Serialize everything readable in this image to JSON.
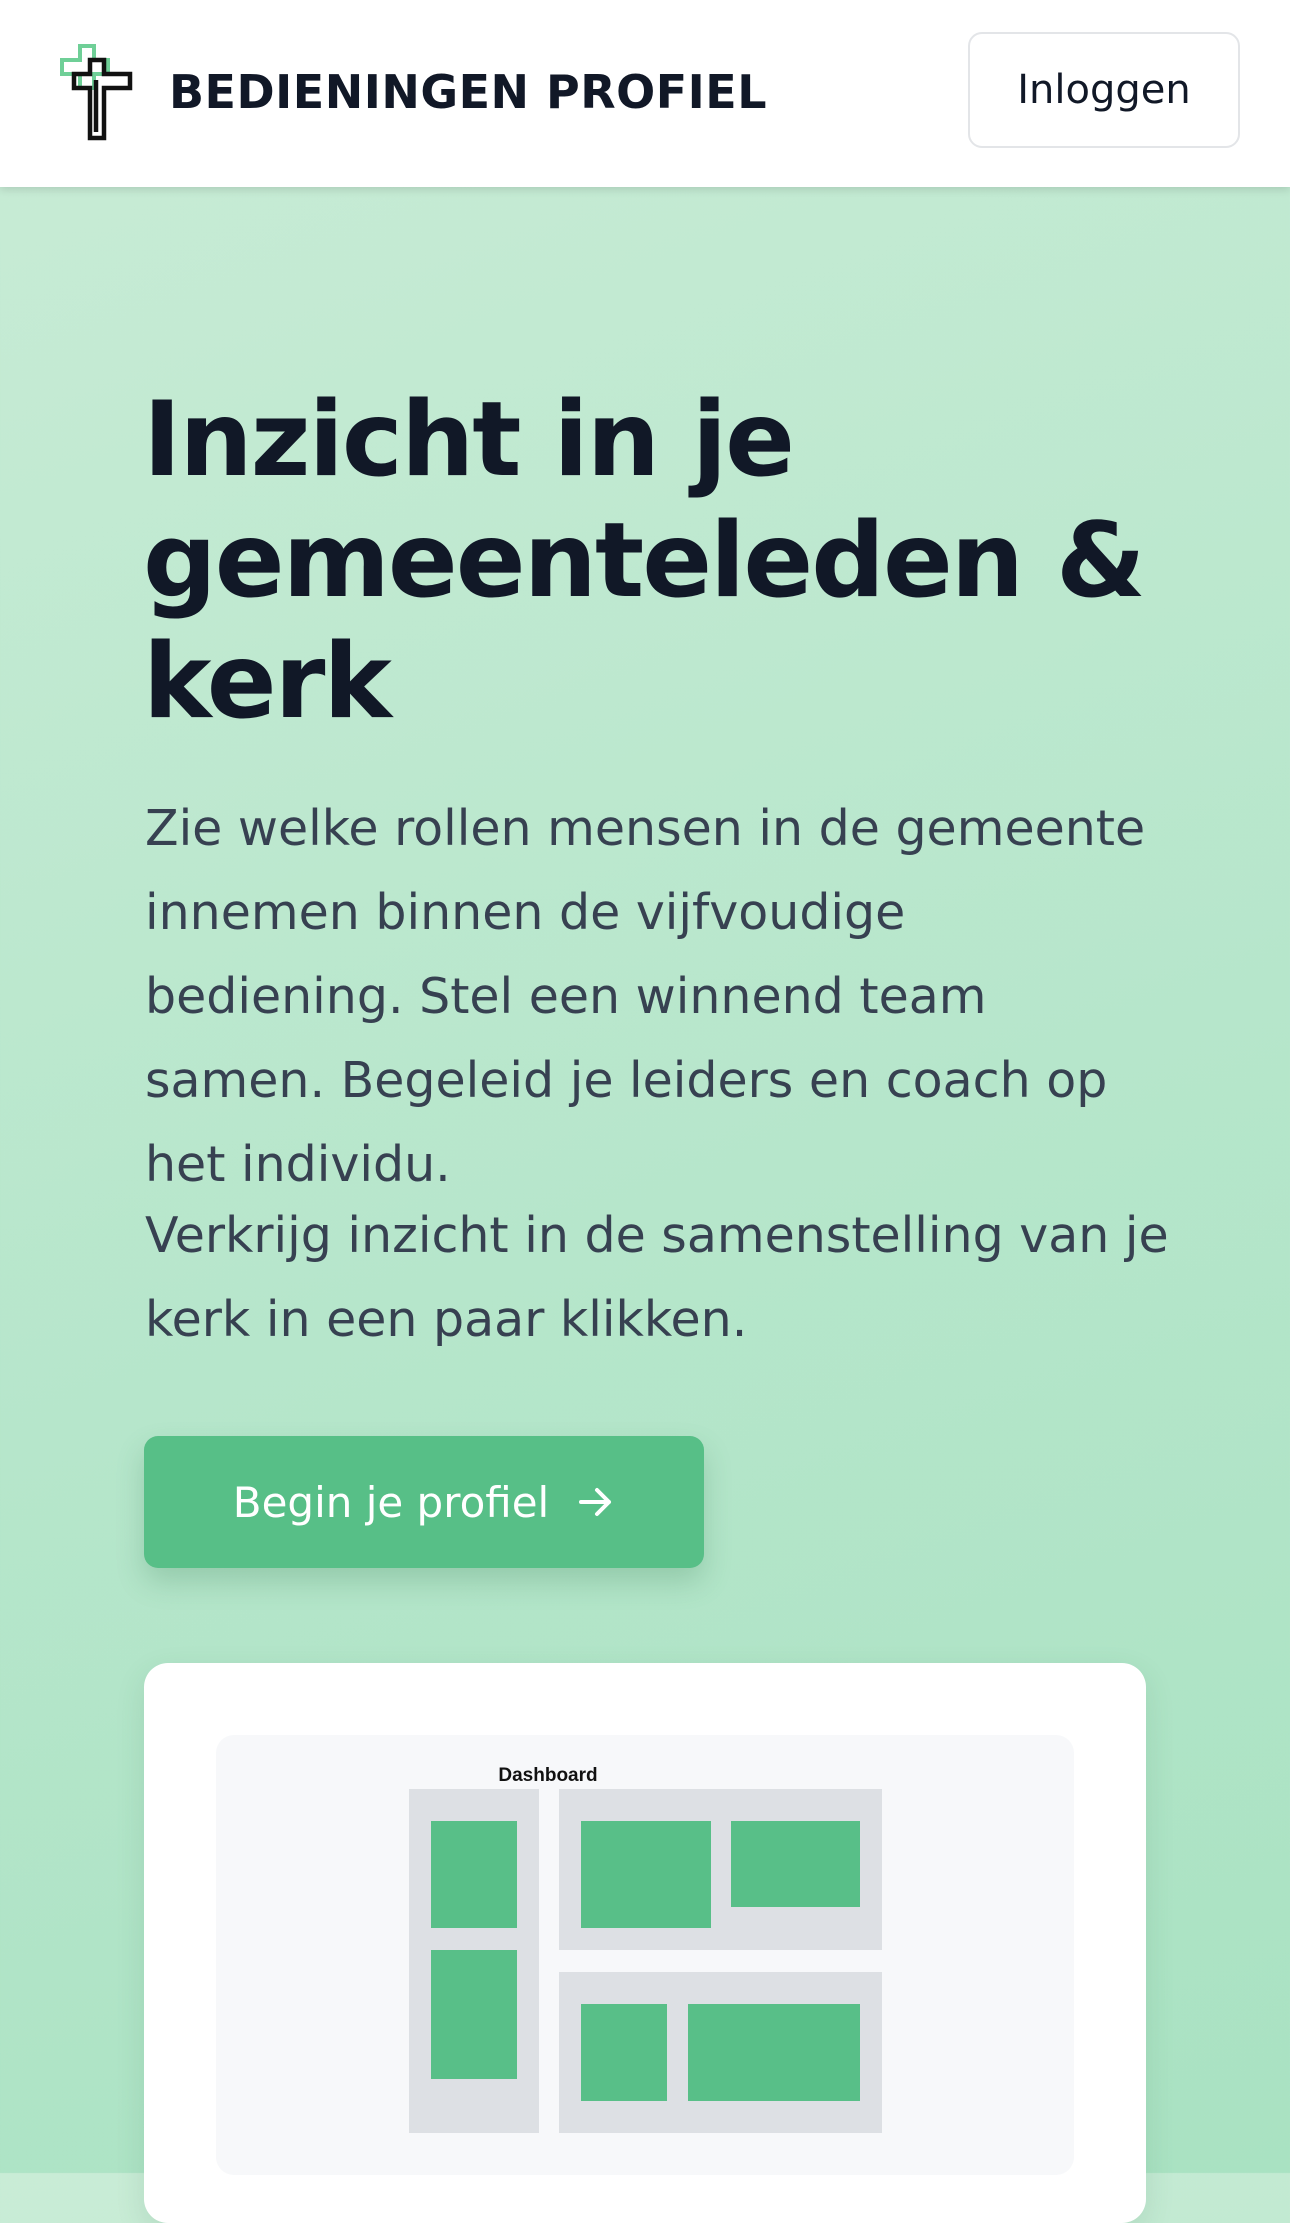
{
  "header": {
    "brand": "BEDIENINGEN PROFIEL",
    "logo_icon": "cross-logo-icon",
    "login_label": "Inloggen"
  },
  "hero": {
    "title": "Inzicht in je gemeenteleden & kerk",
    "paragraph_1": "Zie welke rollen mensen in de gemeente innemen binnen de vijfvoudige bediening. Stel een winnend team samen. Begeleid je leiders en coach op het individu.",
    "paragraph_2": "Verkrijg inzicht in de samenstelling van je kerk in een paar klikken.",
    "cta_label": "Begin je profiel",
    "cta_icon": "arrow-right-icon"
  },
  "preview": {
    "dashboard_title": "Dashboard"
  },
  "colors": {
    "brand_green": "#57bf87",
    "logo_green": "#6fcf97",
    "background_green": "#b6e6cb",
    "text_dark": "#111827",
    "text_body": "#374151"
  }
}
